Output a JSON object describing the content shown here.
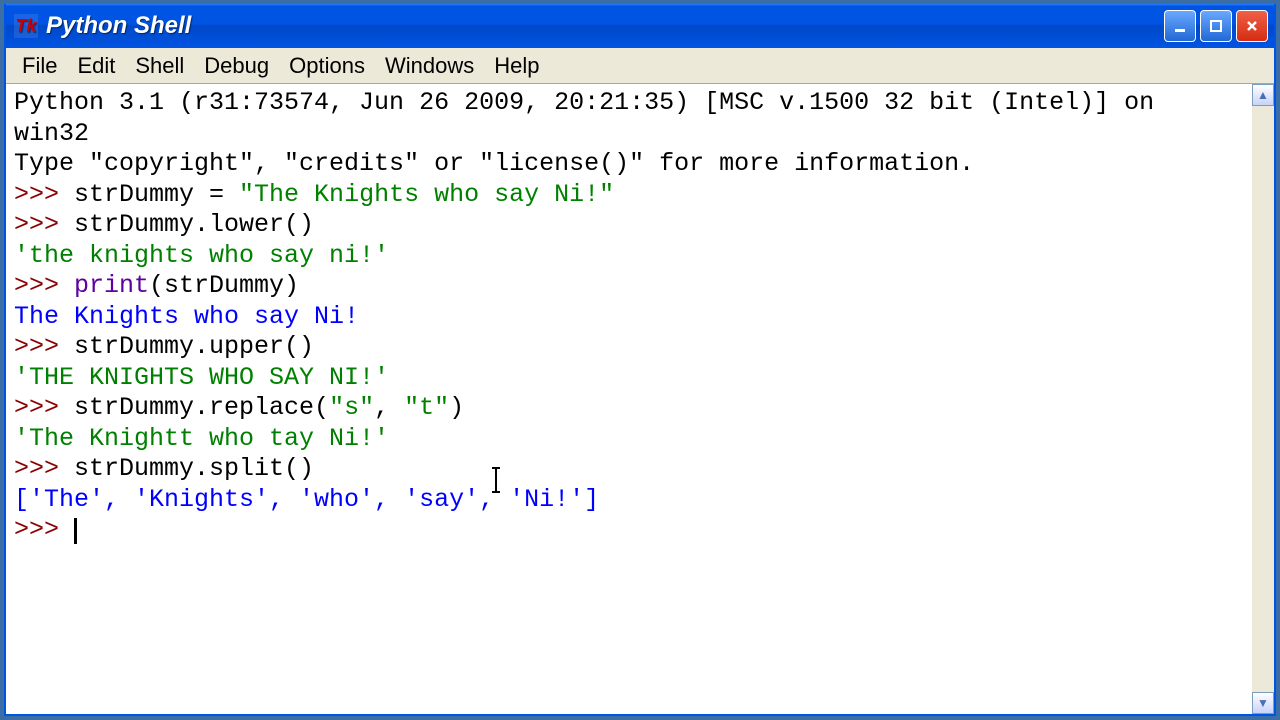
{
  "window": {
    "title": "Python Shell",
    "icon_label": "Tk"
  },
  "menubar": [
    "File",
    "Edit",
    "Shell",
    "Debug",
    "Options",
    "Windows",
    "Help"
  ],
  "colors": {
    "titlebar_blue": "#0054e3",
    "close_red": "#d42d12",
    "prompt": "#8b0000",
    "string": "#008000",
    "stdout": "#0000ff",
    "builtin": "#6000a0"
  },
  "shell": {
    "banner_line1": "Python 3.1 (r31:73574, Jun 26 2009, 20:21:35) [MSC v.1500 32 bit (Intel)] on win32",
    "banner_line2": "Type \"copyright\", \"credits\" or \"license()\" for more information.",
    "prompt": ">>> ",
    "lines": [
      {
        "type": "in",
        "parts": [
          {
            "t": "strDummy = ",
            "c": "input"
          },
          {
            "t": "\"The Knights who say Ni!\"",
            "c": "kw-str"
          }
        ]
      },
      {
        "type": "in",
        "parts": [
          {
            "t": "strDummy.lower()",
            "c": "input"
          }
        ]
      },
      {
        "type": "out",
        "cls": "output-str",
        "text": "'the knights who say ni!'"
      },
      {
        "type": "in",
        "parts": [
          {
            "t": "print",
            "c": "builtin"
          },
          {
            "t": "(strDummy)",
            "c": "input"
          }
        ]
      },
      {
        "type": "out",
        "cls": "output-stdout",
        "text": "The Knights who say Ni!"
      },
      {
        "type": "in",
        "parts": [
          {
            "t": "strDummy.upper()",
            "c": "input"
          }
        ]
      },
      {
        "type": "out",
        "cls": "output-str",
        "text": "'THE KNIGHTS WHO SAY NI!'"
      },
      {
        "type": "in",
        "parts": [
          {
            "t": "strDummy.replace(",
            "c": "input"
          },
          {
            "t": "\"s\"",
            "c": "kw-str"
          },
          {
            "t": ", ",
            "c": "input"
          },
          {
            "t": "\"t\"",
            "c": "kw-str"
          },
          {
            "t": ")",
            "c": "input"
          }
        ]
      },
      {
        "type": "out",
        "cls": "output-str",
        "text": "'The Knightt who tay Ni!'"
      },
      {
        "type": "in",
        "parts": [
          {
            "t": "strDummy.split()",
            "c": "input"
          }
        ]
      },
      {
        "type": "out",
        "cls": "output-repr",
        "text": "['The', 'Knights', 'who', 'say', 'Ni!']"
      }
    ]
  }
}
